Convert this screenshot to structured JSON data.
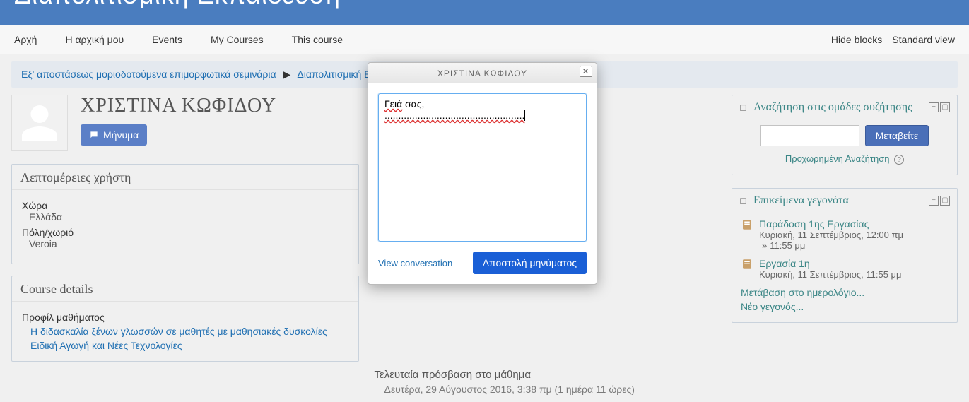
{
  "banner": {
    "title": "Διαπολιτισμική Εκπαίδευση"
  },
  "nav": {
    "home": "Αρχή",
    "myhome": "Η αρχική μου",
    "events": "Events",
    "mycourses": "My Courses",
    "thiscourse": "This course",
    "hideblocks": "Hide blocks",
    "standardview": "Standard view"
  },
  "breadcrumb": {
    "a": "Εξ' αποστάσεως μοριοδοτούμενα επιμορφωτικά σεμινάρια",
    "b": "Διαπολιτισμική Εκ"
  },
  "profile": {
    "name": "ΧΡΙΣΤΙΝΑ ΚΩΦΙΔΟΥ",
    "message_btn": "Μήνυμα"
  },
  "user_details": {
    "title": "Λεπτομέρειες χρήστη",
    "country_label": "Χώρα",
    "country_value": "Ελλάδα",
    "city_label": "Πόλη/χωριό",
    "city_value": "Veroia"
  },
  "course_details": {
    "title": "Course details",
    "profiles_label": "Προφίλ μαθήματος",
    "course1": "Η διδασκαλία ξένων γλωσσών σε μαθητές με μαθησιακές δυσκολίες",
    "course2": "Ειδική Αγωγή και Νέες Τεχνολογίες"
  },
  "last_access": {
    "label": "Τελευταία πρόσβαση στο μάθημα",
    "value": "Δευτέρα, 29 Αύγουστος 2016, 3:38 πμ  (1 ημέρα 11 ώρες)"
  },
  "search_block": {
    "title": "Αναζήτηση στις ομάδες συζήτησης",
    "go": "Μεταβείτε",
    "advanced": "Προχωρημένη Αναζήτηση"
  },
  "events_block": {
    "title": "Επικείμενα γεγονότα",
    "ev1_title": "Παράδοση 1ης Εργασίας",
    "ev1_date_a": "Κυριακή, 11 Σεπτέμβριος",
    "ev1_time_a": "12:00 πμ",
    "ev1_time_b": "11:55 μμ",
    "ev2_title": "Εργασία 1η",
    "ev2_date": "Κυριακή, 11 Σεπτέμβριος",
    "ev2_time": "11:55 μμ",
    "cal_link": "Μετάβαση στο ημερολόγιο...",
    "new_link": "Νέο γεγονός..."
  },
  "dialog": {
    "title": "ΧΡΙΣΤΙΝΑ ΚΩΦΙΔΟΥ",
    "msg_line1_a": "Γειά",
    "msg_line1_b": " σας,",
    "msg_line2": "...................................................",
    "view_conv": "View conversation",
    "send": "Αποστολή μηνύματος"
  }
}
